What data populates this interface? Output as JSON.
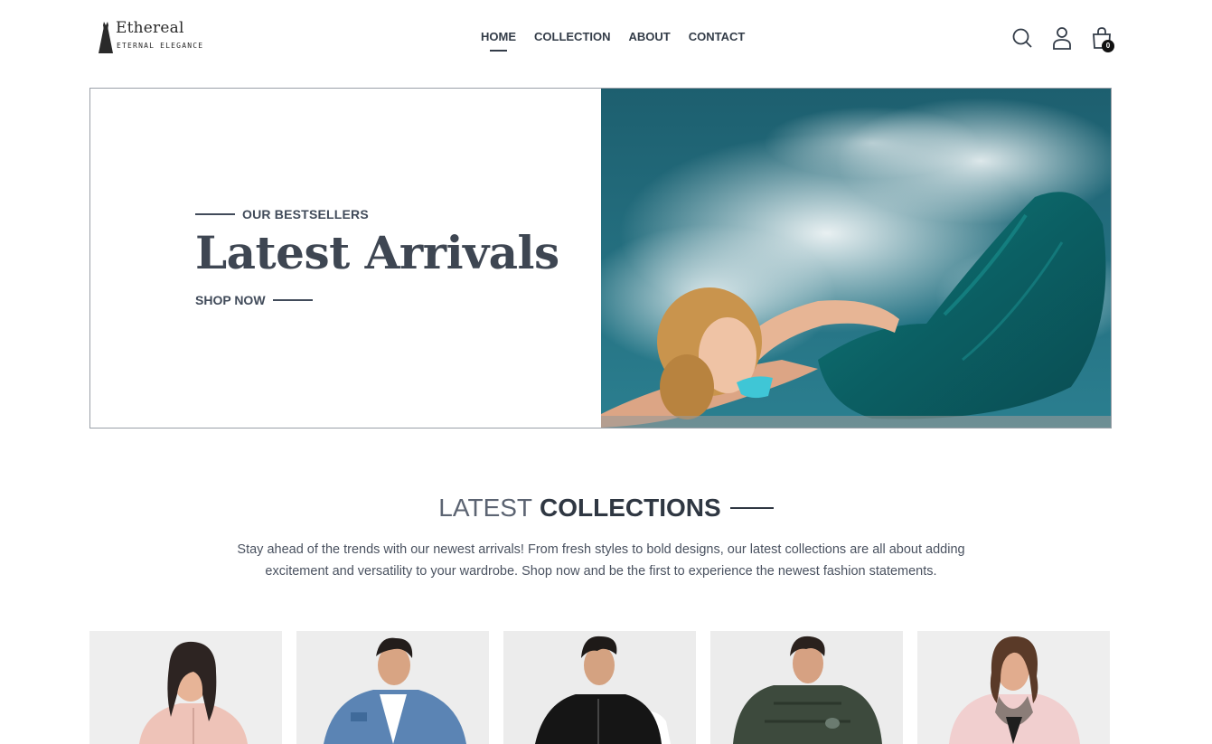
{
  "brand": {
    "name": "Ethereal",
    "tagline": "ETERNAL ELEGANCE"
  },
  "nav": {
    "items": [
      {
        "label": "HOME",
        "active": true
      },
      {
        "label": "COLLECTION",
        "active": false
      },
      {
        "label": "ABOUT",
        "active": false
      },
      {
        "label": "CONTACT",
        "active": false
      }
    ]
  },
  "header_icons": {
    "search": "search-icon",
    "account": "user-icon",
    "cart": "shopping-bag-icon",
    "cart_count": "0"
  },
  "hero": {
    "eyebrow": "OUR BESTSELLERS",
    "title": "Latest Arrivals",
    "cta": "SHOP NOW"
  },
  "collections": {
    "title_light": "LATEST",
    "title_bold": "COLLECTIONS",
    "description": "Stay ahead of the trends with our newest arrivals! From fresh styles to bold designs, our latest collections are all about adding excitement and versatility to your wardrobe. Shop now and be the first to experience the newest fashion statements."
  },
  "colors": {
    "text_dark": "#2f3742",
    "text_muted": "#414b5a",
    "sky": "#1d6b7c",
    "dress_teal": "#0f6d6e"
  }
}
